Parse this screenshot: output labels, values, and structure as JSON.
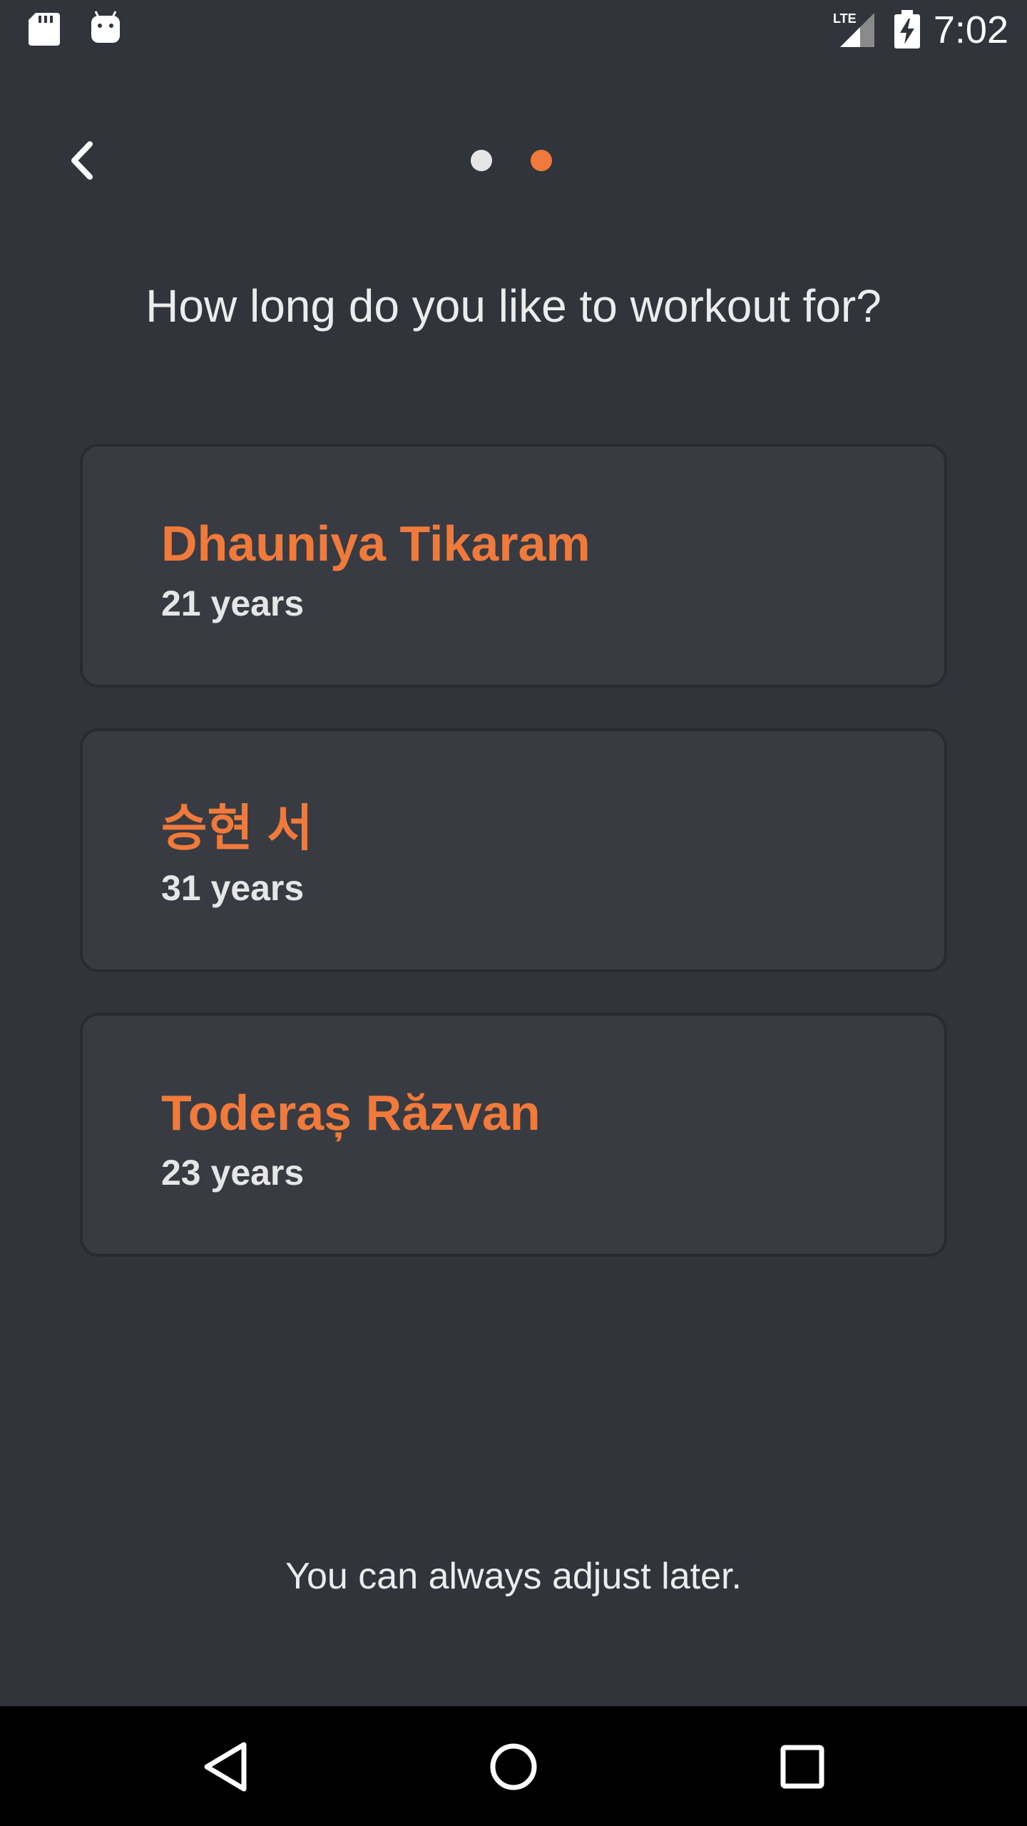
{
  "status_bar": {
    "time": "7:02",
    "network_label": "LTE",
    "icons": [
      "sd-card-icon",
      "android-icon",
      "signal-icon",
      "battery-charging-icon"
    ]
  },
  "onboarding": {
    "back_icon": "chevron-left-icon",
    "pager": {
      "total": 2,
      "current": 2,
      "active_color": "#f07a3c",
      "inactive_color": "#e6e6e6"
    },
    "question": "How long do you like to workout for?",
    "options": [
      {
        "name": "Dhauniya Tikaram",
        "age": "21 years"
      },
      {
        "name": "승현 서",
        "age": "31 years"
      },
      {
        "name": "Toderaș Răzvan",
        "age": "23 years"
      }
    ],
    "footer_note": "You can always adjust later."
  },
  "nav_bar": {
    "icons": [
      "back-triangle-icon",
      "home-circle-icon",
      "recents-square-icon"
    ]
  },
  "colors": {
    "background": "#31343a",
    "card": "#383b41",
    "accent": "#f07a3c",
    "text": "#e6e6e6"
  }
}
